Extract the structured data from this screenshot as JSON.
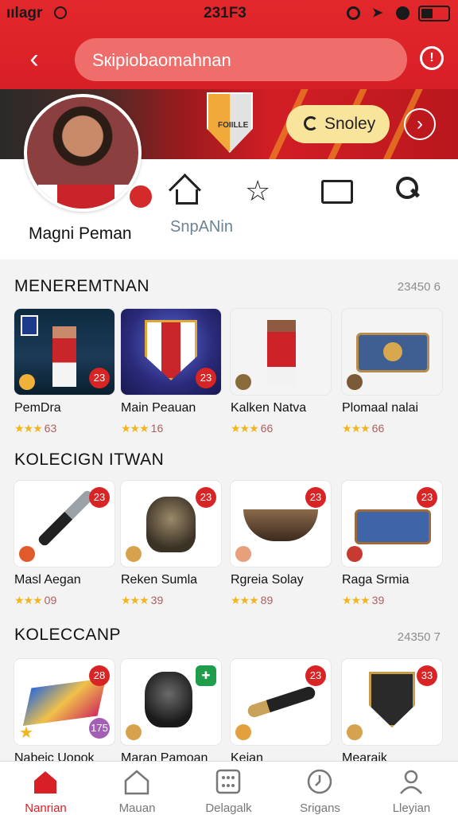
{
  "status_bar": {
    "carrier": "ıılagr",
    "time": "231F3"
  },
  "header": {
    "search_value": "Sкipiobaomahnan"
  },
  "banner": {
    "crest_text": "FOIILLE",
    "action_label": "Snoley"
  },
  "profile": {
    "name": "Magni Peman",
    "nav_caption": "SnpANin"
  },
  "sections": [
    {
      "title": "MENEREMTNAN",
      "count": "23450 6",
      "items": [
        {
          "name": "PemDra",
          "stars": "★★★",
          "count": "63",
          "badge": "23"
        },
        {
          "name": "Main Peauan",
          "stars": "★★★",
          "count": "16",
          "badge": "23"
        },
        {
          "name": "Kalken Natva",
          "stars": "★★★",
          "count": "66",
          "badge": ""
        },
        {
          "name": "Plomaal nalai",
          "stars": "★★★",
          "count": "66",
          "badge": ""
        }
      ]
    },
    {
      "title": "KOLECIGN ITWAN",
      "count": "",
      "items": [
        {
          "name": "Masl Aegan",
          "stars": "★★★",
          "count": "09",
          "badge": "23"
        },
        {
          "name": "Reken Sumla",
          "stars": "★★★",
          "count": "39",
          "badge": "23"
        },
        {
          "name": "Rgreia Solay",
          "stars": "★★★",
          "count": "89",
          "badge": "23"
        },
        {
          "name": "Raga Srmia",
          "stars": "★★★",
          "count": "39",
          "badge": "23"
        }
      ]
    },
    {
      "title": "KOLECCANP",
      "count": "24350 7",
      "items": [
        {
          "name": "Nabeic Uopok",
          "badge": "28",
          "bottom_badge": "175"
        },
        {
          "name": "Maran Pamoan",
          "badge": ""
        },
        {
          "name": "Kejan",
          "badge": "23"
        },
        {
          "name": "Mearaik",
          "badge": "33"
        }
      ]
    }
  ],
  "bottom_nav": [
    {
      "label": "Nanrian",
      "icon": "home-icon",
      "active": true
    },
    {
      "label": "Mauan",
      "icon": "house-outline-icon",
      "active": false
    },
    {
      "label": "Delagalk",
      "icon": "grid-icon",
      "active": false
    },
    {
      "label": "Srigans",
      "icon": "clock-icon",
      "active": false
    },
    {
      "label": "Lleyian",
      "icon": "user-icon",
      "active": false
    }
  ],
  "colors": {
    "primary": "#d71f26",
    "gold": "#f3b51b",
    "action_bg": "#f8e49b",
    "background": "#f3f3f4"
  }
}
